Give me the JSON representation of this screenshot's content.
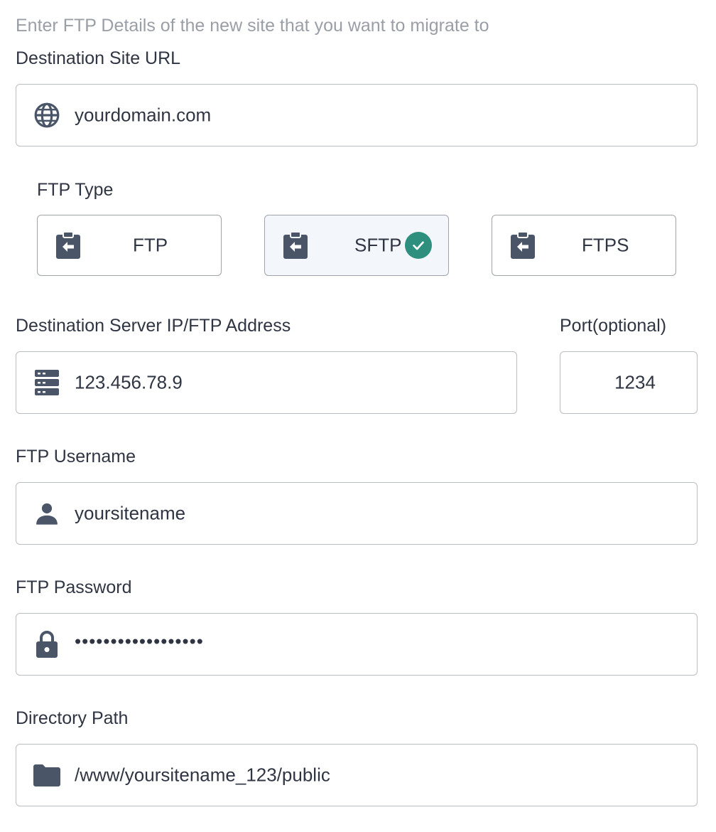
{
  "intro": "Enter FTP Details of the new site that you want to migrate to",
  "destination_url": {
    "label": "Destination Site URL",
    "value": "yourdomain.com",
    "icon": "globe-icon"
  },
  "ftp_type": {
    "label": "FTP Type",
    "options": [
      {
        "label": "FTP",
        "icon": "clipboard-arrow-icon",
        "selected": false
      },
      {
        "label": "SFTP",
        "icon": "clipboard-arrow-icon",
        "selected": true
      },
      {
        "label": "FTPS",
        "icon": "clipboard-arrow-icon",
        "selected": false
      }
    ],
    "check_color": "#2f8f7f"
  },
  "server_address": {
    "label": "Destination Server IP/FTP Address",
    "value": "123.456.78.9",
    "icon": "server-icon"
  },
  "port": {
    "label": "Port(optional)",
    "value": "1234"
  },
  "username": {
    "label": "FTP Username",
    "value": "yoursitename",
    "icon": "user-icon"
  },
  "password": {
    "label": "FTP Password",
    "value": "••••••••••••••••••",
    "icon": "lock-icon"
  },
  "directory": {
    "label": "Directory Path",
    "value": "/www/yoursitename_123/public",
    "icon": "folder-icon"
  },
  "icon_color": "#4a5568"
}
